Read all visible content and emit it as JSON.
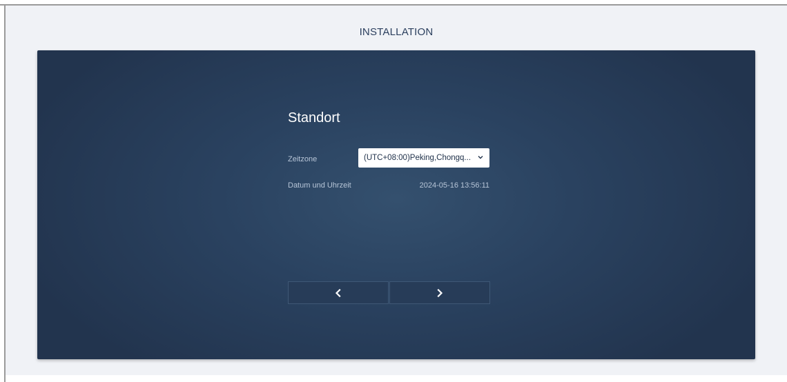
{
  "header": {
    "title": "INSTALLATION"
  },
  "location": {
    "section_title": "Standort",
    "timezone_label": "Zeitzone",
    "timezone_value": "(UTC+08:00)Peking,Chongq...",
    "datetime_label": "Datum und Uhrzeit",
    "datetime_value": "2024-05-16 13:56:11"
  },
  "navigation": {
    "prev_icon": "chevron-left-icon",
    "next_icon": "chevron-right-icon"
  },
  "colors": {
    "page_background": "#f0f2f6",
    "panel_background": "#2a4260",
    "title_text": "#2b3f5e"
  }
}
